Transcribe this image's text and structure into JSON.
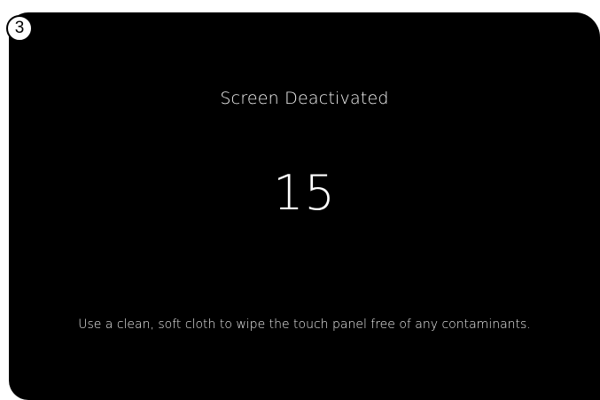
{
  "step_badge": "3",
  "screen": {
    "title": "Screen Deactivated",
    "countdown": "15",
    "instructions": "Use a clean, soft cloth to wipe the touch panel free of any contaminants."
  }
}
